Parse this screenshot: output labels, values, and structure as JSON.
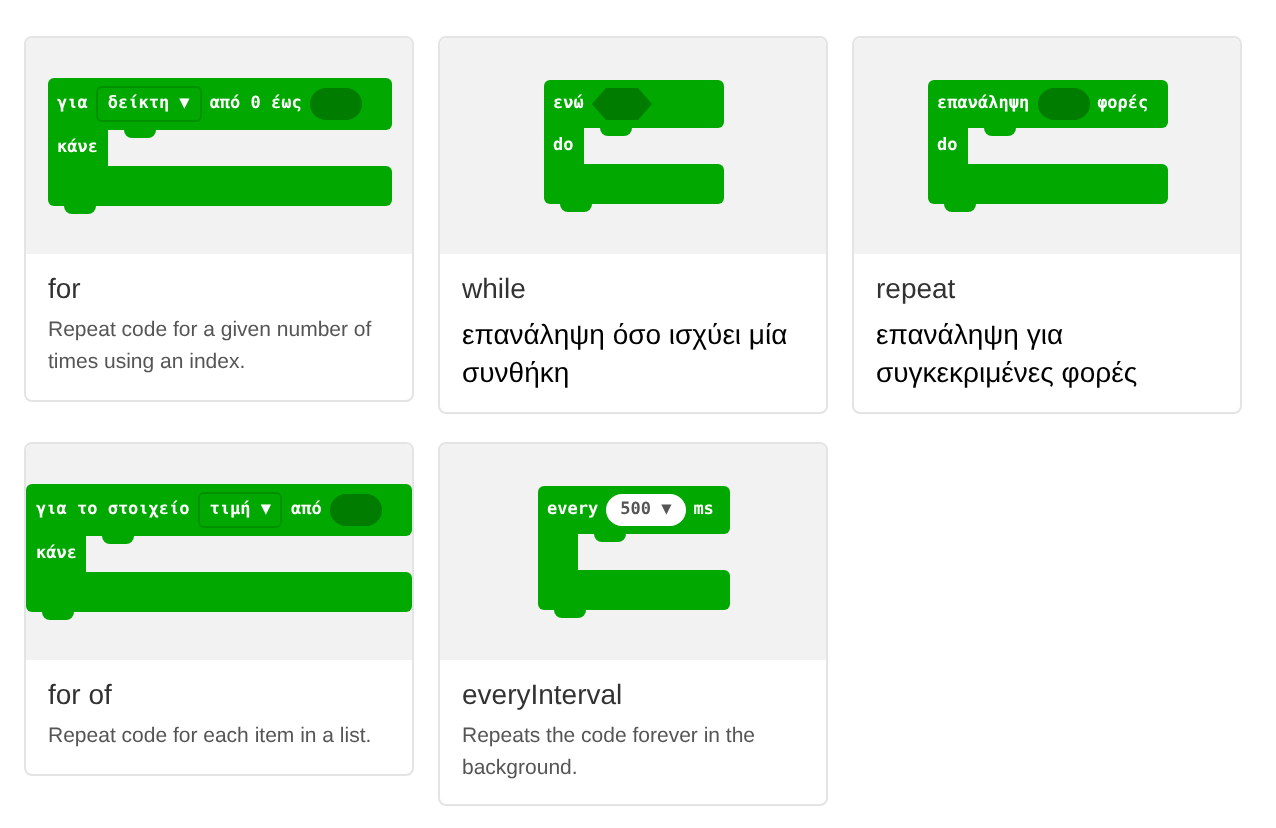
{
  "cards": [
    {
      "title": "for",
      "description": "Repeat code for a given number of times using an index.",
      "kind": "small",
      "block": {
        "kind": "for",
        "segments": [
          {
            "kind": "label",
            "text": "για"
          },
          {
            "kind": "dropdown",
            "text": "δείκτη ▼"
          },
          {
            "kind": "label",
            "text": "από 0 έως"
          },
          {
            "kind": "oval"
          }
        ],
        "do_label": "κάνε"
      }
    },
    {
      "title": "while",
      "description": "επανάληψη όσο ισχύει μία συνθήκη",
      "kind": "large",
      "block": {
        "kind": "while",
        "segments": [
          {
            "kind": "label",
            "text": "ενώ"
          },
          {
            "kind": "hexagon"
          }
        ],
        "do_label": "do"
      }
    },
    {
      "title": "repeat",
      "description": "επανάληψη για συγκεκριμένες φορές",
      "kind": "large",
      "block": {
        "kind": "repeat",
        "segments": [
          {
            "kind": "label",
            "text": "επανάληψη"
          },
          {
            "kind": "oval"
          },
          {
            "kind": "label",
            "text": "φορές"
          }
        ],
        "do_label": "do"
      }
    },
    {
      "title": "for of",
      "description": "Repeat code for each item in a list.",
      "kind": "small",
      "block": {
        "kind": "forof",
        "segments": [
          {
            "kind": "label",
            "text": "για το στοιχείο"
          },
          {
            "kind": "dropdown",
            "text": "τιμή ▼"
          },
          {
            "kind": "label",
            "text": "από"
          },
          {
            "kind": "oval"
          }
        ],
        "do_label": "κάνε"
      }
    },
    {
      "title": "everyInterval",
      "description": "Repeats the code forever in the background.",
      "kind": "small",
      "block": {
        "kind": "every",
        "segments": [
          {
            "kind": "label",
            "text": "every"
          },
          {
            "kind": "pill",
            "text": "500 ▼"
          },
          {
            "kind": "label",
            "text": "ms"
          }
        ]
      }
    }
  ]
}
